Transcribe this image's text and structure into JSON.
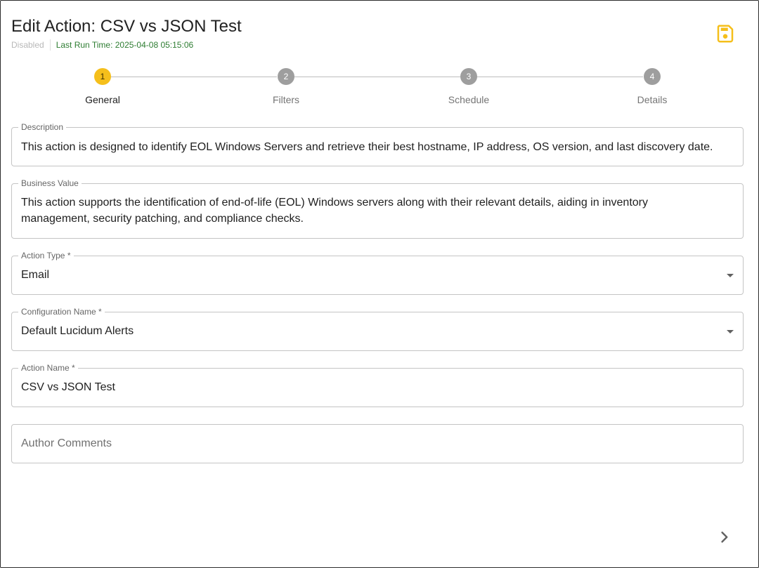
{
  "header": {
    "title": "Edit Action: CSV vs JSON Test",
    "status": "Disabled",
    "last_run": "Last Run Time: 2025-04-08 05:15:06",
    "save_icon": "save-icon",
    "accent_color": "#f5bf1b"
  },
  "stepper": {
    "steps": [
      {
        "number": "1",
        "label": "General"
      },
      {
        "number": "2",
        "label": "Filters"
      },
      {
        "number": "3",
        "label": "Schedule"
      },
      {
        "number": "4",
        "label": "Details"
      }
    ],
    "active_step": 1
  },
  "form": {
    "description": {
      "label": "Description",
      "value": "This action is designed to identify EOL Windows Servers and retrieve their best hostname, IP address, OS version, and last discovery date."
    },
    "business_value": {
      "label": "Business Value",
      "value": "This action supports the identification of end-of-life (EOL) Windows servers along with their relevant details, aiding in inventory management, security patching, and compliance checks."
    },
    "action_type": {
      "label": "Action Type *",
      "value": "Email"
    },
    "configuration_name": {
      "label": "Configuration Name *",
      "value": "Default Lucidum Alerts"
    },
    "action_name": {
      "label": "Action Name *",
      "value": "CSV vs JSON Test"
    },
    "author_comments": {
      "placeholder": "Author Comments",
      "value": ""
    }
  },
  "footer": {
    "next_icon": "chevron-right-icon"
  }
}
